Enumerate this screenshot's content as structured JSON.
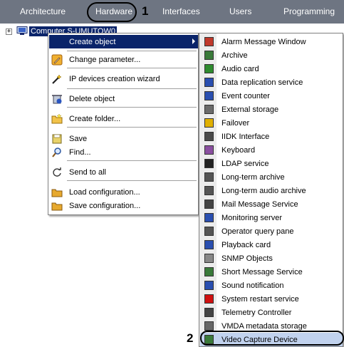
{
  "tabs": [
    {
      "label": "Architecture"
    },
    {
      "label": "Hardware"
    },
    {
      "label": "Interfaces"
    },
    {
      "label": "Users"
    },
    {
      "label": "Programming"
    }
  ],
  "markers": {
    "one": "1",
    "two": "2"
  },
  "tree": {
    "expander": "+",
    "computer_label": "Computer S-UMUTOW0"
  },
  "context_menu": {
    "items": [
      {
        "label": "Create object",
        "icon": "none"
      },
      {
        "label": "Change parameter...",
        "icon": "pencil-icon"
      },
      {
        "label": "IP devices creation wizard",
        "icon": "wand-icon"
      },
      {
        "label": "Delete object",
        "icon": "delete-icon"
      },
      {
        "label": "Create folder...",
        "icon": "folder-icon"
      },
      {
        "label": "Save",
        "icon": "save-icon"
      },
      {
        "label": "Find...",
        "icon": "magnifier-icon"
      },
      {
        "label": "Send to all",
        "icon": "refresh-icon"
      },
      {
        "label": "Load configuration...",
        "icon": "folder-load-icon"
      },
      {
        "label": "Save configuration...",
        "icon": "folder-save-icon"
      }
    ]
  },
  "submenu": {
    "items": [
      {
        "label": "Alarm Message Window",
        "icon": "alarm-window-icon",
        "color": "#c0392b"
      },
      {
        "label": "Archive",
        "icon": "archive-icon",
        "color": "#3a7a3a"
      },
      {
        "label": "Audio card",
        "icon": "audio-card-icon",
        "color": "#2e8b2e"
      },
      {
        "label": "Data replication service",
        "icon": "replication-icon",
        "color": "#2a4fb0"
      },
      {
        "label": "Event counter",
        "icon": "counter-icon",
        "color": "#2a4fb0"
      },
      {
        "label": "External storage",
        "icon": "storage-icon",
        "color": "#6b6b6b"
      },
      {
        "label": "Failover",
        "icon": "failover-icon",
        "color": "#e0b000"
      },
      {
        "label": "IIDK Interface",
        "icon": "iidk-icon",
        "color": "#4a4a4a"
      },
      {
        "label": "Keyboard",
        "icon": "keyboard-icon",
        "color": "#8a4fa0"
      },
      {
        "label": "LDAP service",
        "icon": "ldap-icon",
        "color": "#222222"
      },
      {
        "label": "Long-term archive",
        "icon": "long-archive-icon",
        "color": "#555555"
      },
      {
        "label": "Long-term audio archive",
        "icon": "audio-archive-icon",
        "color": "#555555"
      },
      {
        "label": "Mail Message Service",
        "icon": "mail-icon",
        "color": "#444444"
      },
      {
        "label": "Monitoring server",
        "icon": "monitor-server-icon",
        "color": "#2a4fb0"
      },
      {
        "label": "Operator query pane",
        "icon": "query-pane-icon",
        "color": "#555555"
      },
      {
        "label": "Playback card",
        "icon": "playback-card-icon",
        "color": "#2a4fb0"
      },
      {
        "label": "SNMP Objects",
        "icon": "snmp-icon",
        "color": "#888888"
      },
      {
        "label": "Short Message Service",
        "icon": "sms-icon",
        "color": "#3a7a3a"
      },
      {
        "label": "Sound notification",
        "icon": "sound-icon",
        "color": "#2a4fb0"
      },
      {
        "label": "System restart service",
        "icon": "restart-icon",
        "color": "#d01010"
      },
      {
        "label": "Telemetry Controller",
        "icon": "telemetry-icon",
        "color": "#444444"
      },
      {
        "label": "VMDA metadata storage",
        "icon": "vmda-icon",
        "color": "#666666"
      },
      {
        "label": "Video Capture Device",
        "icon": "video-capture-icon",
        "color": "#3a7a3a"
      }
    ]
  },
  "colors": {
    "tabbar": "#6e7582",
    "selection": "#0a246a",
    "submenu_highlight": "#c1d2ee"
  }
}
